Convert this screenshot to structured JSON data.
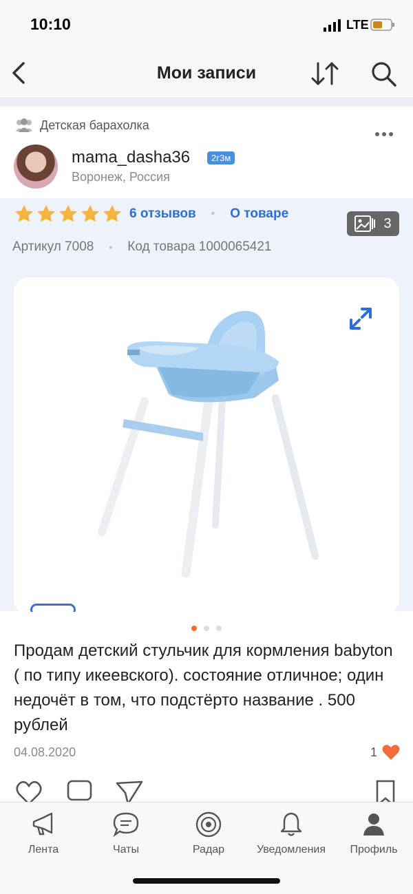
{
  "status": {
    "time": "10:10",
    "network": "LTE"
  },
  "header": {
    "title": "Мои записи"
  },
  "post": {
    "community": "Детская барахолка",
    "username": "mama_dasha36",
    "badge": "2г3м",
    "location": "Воронеж, Россия",
    "rating_stars": 5,
    "reviews": "6 отзывов",
    "about": "О товаре",
    "photo_count": "3",
    "article": "Артикул 7008",
    "product_code": "Код товара 1000065421",
    "description": "Продам детский стульчик для кормления babyton ( по типу икеевского). состояние отличное; один недочёт в том, что подстёрто название . 500 рублей",
    "date": "04.08.2020",
    "likes": "1"
  },
  "tabs": [
    {
      "label": "Лента",
      "icon": "megaphone-icon"
    },
    {
      "label": "Чаты",
      "icon": "chat-bubble-icon"
    },
    {
      "label": "Радар",
      "icon": "radar-icon"
    },
    {
      "label": "Уведомления",
      "icon": "bell-icon"
    },
    {
      "label": "Профиль",
      "icon": "person-icon"
    }
  ],
  "colors": {
    "accent": "#2d6dd9",
    "star": "#f4b63d",
    "like": "#f06c3a",
    "product_bg": "#edf2fb"
  }
}
